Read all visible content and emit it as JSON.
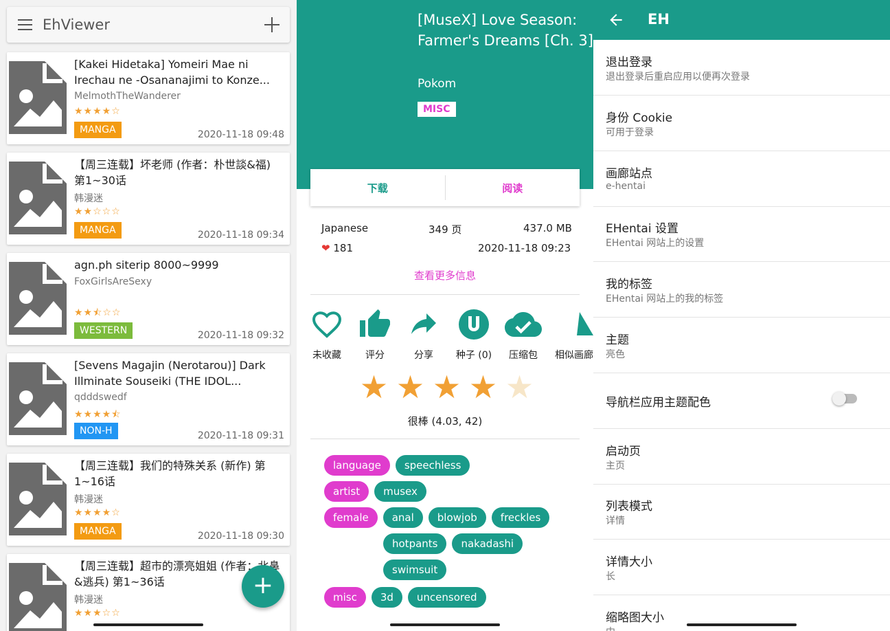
{
  "list": {
    "app_title": "EhViewer",
    "items": [
      {
        "title": "[Kakei Hidetaka] Yomeiri Mae ni Irechau ne -Osananajimi to Konze...",
        "uploader": "MelmothTheWanderer",
        "stars": "★★★★☆",
        "category": "MANGA",
        "cat_color": "#f39b12",
        "date": "2020-11-18 09:48",
        "rating": 4
      },
      {
        "title": "【周三连载】坏老师 (作者：朴世談&福) 第1~30话",
        "uploader": "韩漫迷",
        "stars": "★★☆☆☆",
        "category": "MANGA",
        "cat_color": "#f39b12",
        "date": "2020-11-18 09:34",
        "rating": 2
      },
      {
        "title": "agn.ph siterip 8000~9999",
        "uploader": "FoxGirlsAreSexy",
        "stars": "★★⯪☆☆",
        "category": "WESTERN",
        "cat_color": "#7cbb3c",
        "date": "2020-11-18 09:32",
        "rating": 2.5
      },
      {
        "title": "[Sevens Magajin (Nerotarou)] Dark Illminate Souseiki (THE IDOL...",
        "uploader": "qdddswedf",
        "stars": "★★★★⯪",
        "category": "NON-H",
        "cat_color": "#2196f3",
        "date": "2020-11-18 09:31",
        "rating": 4.5
      },
      {
        "title": "【周三连载】我们的特殊关系 (新作) 第1~16话",
        "uploader": "韩漫迷",
        "stars": "★★★★☆",
        "category": "MANGA",
        "cat_color": "#f39b12",
        "date": "2020-11-18 09:30",
        "rating": 4
      },
      {
        "title": "【周三连载】超市的漂亮姐姐 (作者：北鼻&逃兵) 第1~36话",
        "uploader": "韩漫迷",
        "stars": "★★★☆☆",
        "category": "",
        "cat_color": "#f39b12",
        "date": "",
        "rating": 3
      }
    ]
  },
  "detail": {
    "title": "[MuseX] Love Season: Farmer's Dreams [Ch. 3]",
    "uploader": "Pokom",
    "category": "MISC",
    "download_label": "下载",
    "read_label": "阅读",
    "language": "Japanese",
    "pages": "349 页",
    "size": "437.0 MB",
    "favorites": "181",
    "posted": "2020-11-18 09:23",
    "more_info": "查看更多信息",
    "actions": [
      "未收藏",
      "评分",
      "分享",
      "种子 (0)",
      "压缩包",
      "相似画廊"
    ],
    "rating": 4.03,
    "rating_text": "很棒 (4.03, 42)",
    "tag_groups": [
      {
        "ns": "language",
        "tags": [
          "speechless"
        ]
      },
      {
        "ns": "artist",
        "tags": [
          "musex"
        ]
      },
      {
        "ns": "female",
        "tags": [
          "anal",
          "blowjob",
          "freckles",
          "hotpants",
          "nakadashi",
          "swimsuit"
        ]
      },
      {
        "ns": "misc",
        "tags": [
          "3d",
          "uncensored"
        ]
      }
    ],
    "colors": {
      "accent": "#1a9b8a",
      "namespace": "#e03ccd"
    }
  },
  "settings": {
    "title": "EH",
    "rows": [
      {
        "title": "退出登录",
        "subtitle": "退出登录后重启应用以便再次登录"
      },
      {
        "title": "身份 Cookie",
        "subtitle": "可用于登录"
      },
      {
        "title": "画廊站点",
        "subtitle": "e-hentai"
      },
      {
        "title": "EHentai 设置",
        "subtitle": "EHentai 网站上的设置"
      },
      {
        "title": "我的标签",
        "subtitle": "EHentai 网站上的我的标签"
      },
      {
        "title": "主题",
        "subtitle": "亮色"
      },
      {
        "title": "导航栏应用主题配色",
        "subtitle": ""
      },
      {
        "title": "启动页",
        "subtitle": "主页"
      },
      {
        "title": "列表模式",
        "subtitle": "详情"
      },
      {
        "title": "详情大小",
        "subtitle": "长"
      },
      {
        "title": "缩略图大小",
        "subtitle": "中"
      }
    ],
    "nav_theme_toggle": false
  }
}
